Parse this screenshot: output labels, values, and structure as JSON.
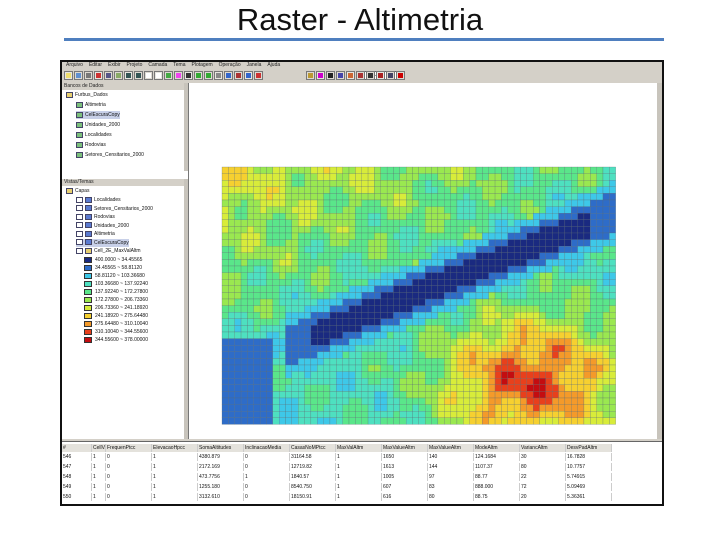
{
  "slide": {
    "title": "Raster - Altimetria"
  },
  "app": {
    "menu": [
      "Arquivo",
      "Editar",
      "Exibir",
      "Projeto",
      "Camada",
      "Tema",
      "Plotagem",
      "Operação",
      "Janela",
      "Ajuda"
    ],
    "scale": "763470",
    "colors": {
      "face": "#d4d0c8",
      "water": "#10246e",
      "selection": "#c8d0e8"
    }
  },
  "database": {
    "header": "Bancos de Dados",
    "items": [
      {
        "label": "Furbus_Dados",
        "level": 1
      },
      {
        "label": "Altimetria",
        "level": 2
      },
      {
        "label": "CelEscuraCopy",
        "level": 2
      },
      {
        "label": "Unidades_2000",
        "level": 2
      },
      {
        "label": "Localidades",
        "level": 2
      },
      {
        "label": "Rodovias",
        "level": 2
      },
      {
        "label": "Setores_Censitarios_2000",
        "level": 2
      }
    ]
  },
  "views": {
    "header": "Vistas/Temas",
    "root": "Capas",
    "items": [
      {
        "label": "Localidades"
      },
      {
        "label": "Setores_Censitarios_2000"
      },
      {
        "label": "Rodovias"
      },
      {
        "label": "Unidades_2000"
      },
      {
        "label": "Altimetria"
      },
      {
        "label": "CelEscuraCopy"
      },
      {
        "label": "Cell_2E_MaxValAltm"
      }
    ],
    "legend": [
      {
        "label": "400.0000 ~ 34.45565",
        "color": "#1a2a80"
      },
      {
        "label": "34.45565 ~ 58.81120",
        "color": "#2e6cc8"
      },
      {
        "label": "58.81120 ~ 103.36680",
        "color": "#3ec8e8"
      },
      {
        "label": "103.36680 ~ 137.92240",
        "color": "#4ee0c0"
      },
      {
        "label": "137.92240 ~ 172.27800",
        "color": "#5ae68a"
      },
      {
        "label": "172.27800 ~ 206.73360",
        "color": "#9ae850"
      },
      {
        "label": "206.73360 ~ 241.18920",
        "color": "#d8ec3a"
      },
      {
        "label": "241.18920 ~ 275.64480",
        "color": "#f6d030"
      },
      {
        "label": "275.64480 ~ 310.10040",
        "color": "#f49a2a"
      },
      {
        "label": "310.10040 ~ 344.55600",
        "color": "#e8401c"
      },
      {
        "label": "344.55600 ~ 378.00000",
        "color": "#c40c10"
      }
    ]
  },
  "table": {
    "columns": [
      "#",
      "CellValueHps",
      "FrequenPtcc",
      "ElevacaoHpcc",
      "SomaAltitudes",
      "InclinacaoMedia",
      "CasasNoMPtcc",
      "MaxValAltm",
      "MaxValueAltm",
      "MaxValueAltm",
      "ModeAltm",
      "VariancAltm",
      "DesvPadAltm"
    ],
    "rows": [
      [
        "546",
        "1",
        "0",
        "1",
        "4380.879",
        "0",
        "31164.58",
        "1",
        "1650",
        "140",
        "124.1684",
        "30",
        "16.7828"
      ],
      [
        "547",
        "1",
        "0",
        "1",
        "2172.169",
        "0",
        "12719.82",
        "1",
        "1613",
        "144",
        "1107.37",
        "80",
        "10.7757"
      ],
      [
        "548",
        "1",
        "0",
        "1",
        "473.7756",
        "1",
        "1840.57",
        "1",
        "1005",
        "97",
        "88.77",
        "22",
        "5.74915"
      ],
      [
        "549",
        "1",
        "0",
        "1",
        "1255.180",
        "0",
        "8540.750",
        "1",
        "607",
        "83",
        "888.000",
        "72",
        "5.09469"
      ],
      [
        "550",
        "1",
        "0",
        "1",
        "3132.610",
        "0",
        "18150.91",
        "1",
        "616",
        "80",
        "88.75",
        "20",
        "5.36361"
      ]
    ]
  }
}
